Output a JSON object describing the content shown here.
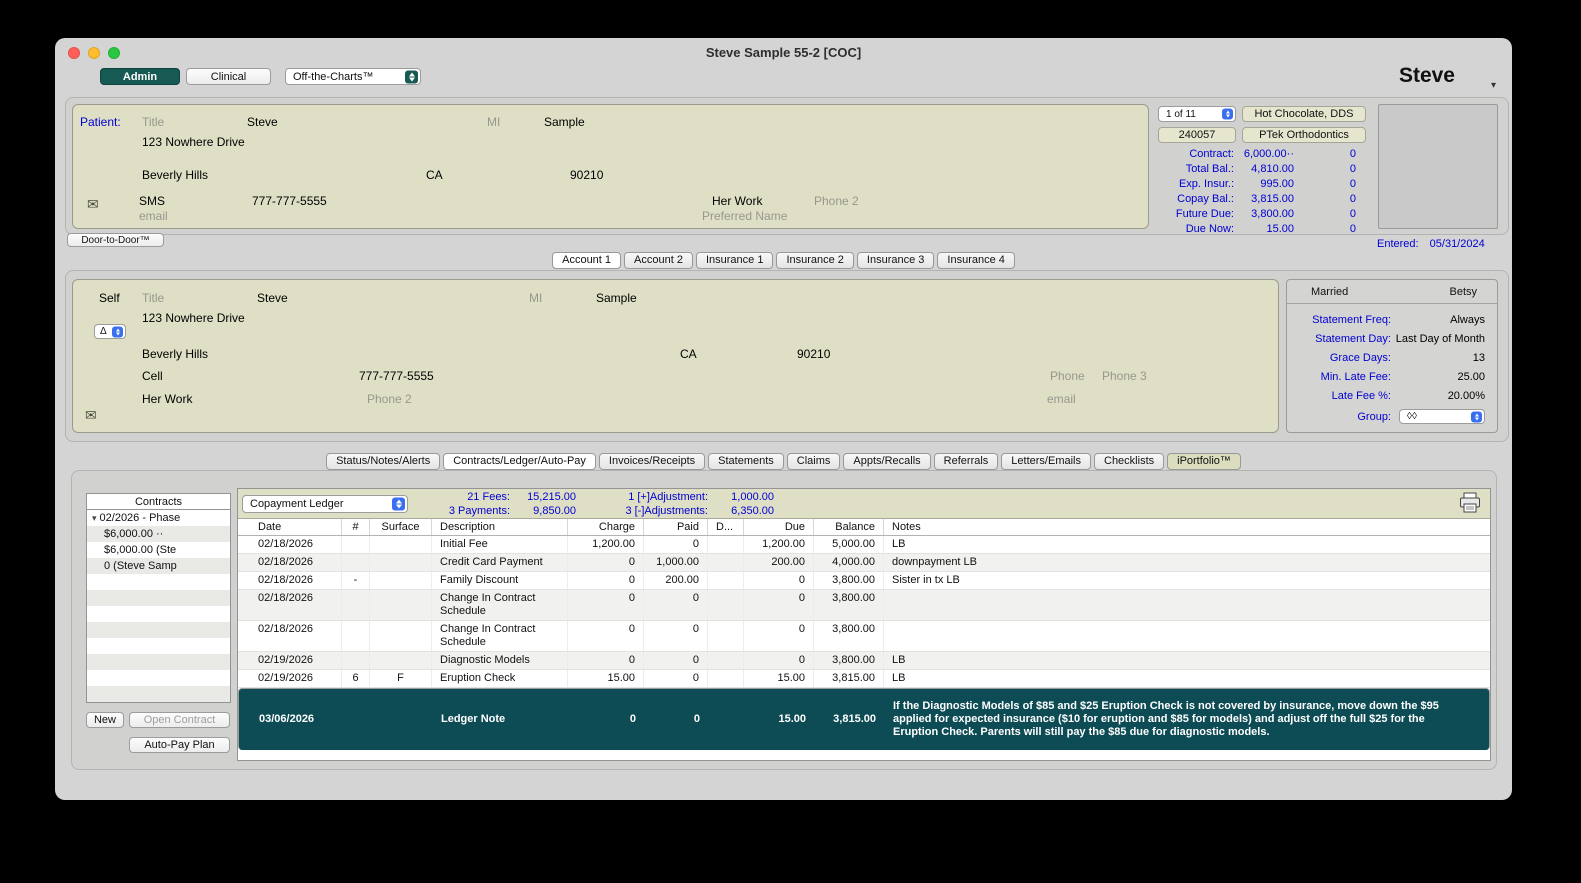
{
  "colors": {
    "accent_teal": "#175a54",
    "selected_row_teal": "#0d4b55",
    "link_blue": "#0000d4",
    "panel_beige": "#dfdfc6"
  },
  "icons": {
    "envelope": "✉",
    "disclosure_open": "▾",
    "chevron_down": "▾",
    "delta": "Δ"
  },
  "window": {
    "title": "Steve Sample 55-2 [COC]",
    "user_label": "Steve"
  },
  "toolbar": {
    "admin": "Admin",
    "clinical": "Clinical",
    "off_the_charts": "Off-the-Charts™"
  },
  "patient": {
    "label": "Patient:",
    "title_placeholder": "Title",
    "first_name": "Steve",
    "mi_label": "MI",
    "last_name": "Sample",
    "address": "123 Nowhere Drive",
    "city": "Beverly Hills",
    "state": "CA",
    "zip": "90210",
    "sms_label": "SMS",
    "phone": "777-777-5555",
    "work_label": "Her Work",
    "phone2_placeholder": "Phone 2",
    "email_placeholder": "email",
    "preferred_name_placeholder": "Preferred Name",
    "door_to_door": "Door-to-Door™"
  },
  "summary_panel": {
    "record_nav": "1 of 11",
    "provider": "Hot Chocolate, DDS",
    "patient_id": "240057",
    "practice": "PTek Orthodontics",
    "financials": [
      {
        "label": "Contract:",
        "value": "6,000.00··",
        "flag": "0"
      },
      {
        "label": "Total Bal.:",
        "value": "4,810.00",
        "flag": "0"
      },
      {
        "label": "Exp. Insur.:",
        "value": "995.00",
        "flag": "0"
      },
      {
        "label": "Copay Bal.:",
        "value": "3,815.00",
        "flag": "0"
      },
      {
        "label": "Future Due:",
        "value": "3,800.00",
        "flag": "0"
      },
      {
        "label": "Due Now:",
        "value": "15.00",
        "flag": "0"
      }
    ],
    "entered_label": "Entered:",
    "entered_date": "05/31/2024"
  },
  "account_tabs": [
    {
      "label": "Account 1"
    },
    {
      "label": "Account 2"
    },
    {
      "label": "Insurance 1"
    },
    {
      "label": "Insurance 2"
    },
    {
      "label": "Insurance 3"
    },
    {
      "label": "Insurance 4"
    }
  ],
  "account": {
    "relation": "Self",
    "title_placeholder": "Title",
    "first_name": "Steve",
    "mi_label": "MI",
    "last_name": "Sample",
    "address": "123 Nowhere Drive",
    "city": "Beverly Hills",
    "state": "CA",
    "zip": "90210",
    "cell_label": "Cell",
    "phone": "777-777-5555",
    "phone_placeholder": "Phone",
    "phone3_placeholder": "Phone 3",
    "work_label": "Her Work",
    "phone2_placeholder": "Phone 2",
    "email_placeholder": "email"
  },
  "billing": {
    "marital_status": "Married",
    "spouse": "Betsy",
    "rows": [
      {
        "label": "Statement Freq:",
        "value": "Always"
      },
      {
        "label": "Statement Day:",
        "value": "Last Day of Month"
      },
      {
        "label": "Grace Days:",
        "value": "13"
      },
      {
        "label": "Min. Late Fee:",
        "value": "25.00"
      },
      {
        "label": "Late Fee %:",
        "value": "20.00%"
      }
    ],
    "group_label": "Group:",
    "group_value": "◊◊"
  },
  "main_tabs": [
    {
      "label": "Status/Notes/Alerts"
    },
    {
      "label": "Contracts/Ledger/Auto-Pay"
    },
    {
      "label": "Invoices/Receipts"
    },
    {
      "label": "Statements"
    },
    {
      "label": "Claims"
    },
    {
      "label": "Appts/Recalls"
    },
    {
      "label": "Referrals"
    },
    {
      "label": "Letters/Emails"
    },
    {
      "label": "Checklists"
    },
    {
      "label": "iPortfolio™"
    }
  ],
  "contracts": {
    "header": "Contracts",
    "tree_root": "02/2026 - Phase",
    "items": [
      "$6,000.00 ··",
      "$6,000.00 (Ste",
      "0 (Steve Samp"
    ],
    "new_button": "New",
    "open_contract_button": "Open Contract",
    "auto_pay_button": "Auto-Pay Plan"
  },
  "ledger": {
    "view_selector": "Copayment Ledger",
    "summary": {
      "fees_label": "21 Fees:",
      "fees_value": "15,215.00",
      "payments_label": "3 Payments:",
      "payments_value": "9,850.00",
      "plus_adj_label": "1 [+]Adjustment:",
      "plus_adj_value": "1,000.00",
      "minus_adj_label": "3 [-]Adjustments:",
      "minus_adj_value": "6,350.00"
    },
    "columns": [
      "Date",
      "#",
      "Surface",
      "Description",
      "Charge",
      "Paid",
      "D...",
      "Due",
      "Balance",
      "Notes"
    ],
    "rows": [
      {
        "date": "02/18/2026",
        "num": "",
        "surface": "",
        "description": "Initial Fee",
        "charge": "1,200.00",
        "paid": "0",
        "d": "",
        "due": "1,200.00",
        "balance": "5,000.00",
        "notes": "LB"
      },
      {
        "date": "02/18/2026",
        "num": "",
        "surface": "",
        "description": "Credit Card Payment",
        "charge": "0",
        "paid": "1,000.00",
        "d": "",
        "due": "200.00",
        "balance": "4,000.00",
        "notes": "downpayment LB"
      },
      {
        "date": "02/18/2026",
        "num": "-",
        "surface": "",
        "description": "Family Discount",
        "charge": "0",
        "paid": "200.00",
        "d": "",
        "due": "0",
        "balance": "3,800.00",
        "notes": "Sister in tx LB"
      },
      {
        "date": "02/18/2026",
        "num": "",
        "surface": "",
        "description": "Change In Contract Schedule",
        "charge": "0",
        "paid": "0",
        "d": "",
        "due": "0",
        "balance": "3,800.00",
        "notes": ""
      },
      {
        "date": "02/18/2026",
        "num": "",
        "surface": "",
        "description": "Change In Contract Schedule",
        "charge": "0",
        "paid": "0",
        "d": "",
        "due": "0",
        "balance": "3,800.00",
        "notes": ""
      },
      {
        "date": "02/19/2026",
        "num": "",
        "surface": "",
        "description": "Diagnostic Models",
        "charge": "0",
        "paid": "0",
        "d": "",
        "due": "0",
        "balance": "3,800.00",
        "notes": "LB"
      },
      {
        "date": "02/19/2026",
        "num": "6",
        "surface": "F",
        "description": "Eruption Check",
        "charge": "15.00",
        "paid": "0",
        "d": "",
        "due": "15.00",
        "balance": "3,815.00",
        "notes": "LB"
      },
      {
        "date": "03/06/2026",
        "num": "",
        "surface": "",
        "description": "Ledger Note",
        "charge": "0",
        "paid": "0",
        "d": "",
        "due": "15.00",
        "balance": "3,815.00",
        "notes": "If the Diagnostic Models of $85 and $25 Eruption Check is not covered by insurance, move down the $95 applied for expected insurance ($10 for eruption and $85 for models) and adjust off the full $25 for the Eruption Check. Parents will still pay the $85 due for diagnostic models."
      }
    ]
  }
}
